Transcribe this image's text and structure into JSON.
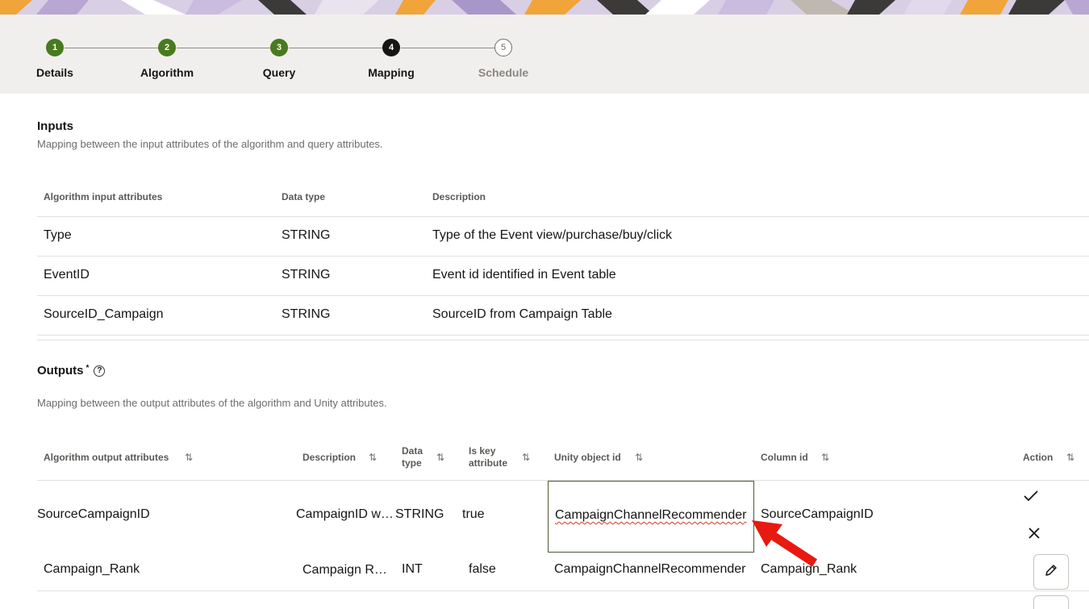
{
  "wizard": {
    "steps": [
      {
        "number": "1",
        "label": "Details",
        "state": "done"
      },
      {
        "number": "2",
        "label": "Algorithm",
        "state": "done"
      },
      {
        "number": "3",
        "label": "Query",
        "state": "done"
      },
      {
        "number": "4",
        "label": "Mapping",
        "state": "current"
      },
      {
        "number": "5",
        "label": "Schedule",
        "state": "future"
      }
    ]
  },
  "inputs": {
    "title": "Inputs",
    "description": "Mapping between the input attributes of the algorithm and query attributes.",
    "columns": [
      "Algorithm input attributes",
      "Data type",
      "Description"
    ],
    "rows": [
      [
        "Type",
        "STRING",
        "Type of the Event view/purchase/buy/click"
      ],
      [
        "EventID",
        "STRING",
        "Event id identified in Event table"
      ],
      [
        "SourceID_Campaign",
        "STRING",
        "SourceID from Campaign Table"
      ]
    ]
  },
  "outputs": {
    "title": "Outputs",
    "required_mark": "*",
    "help_icon": "help-circle-icon",
    "description": "Mapping between the output attributes of the algorithm and Unity attributes.",
    "columns": {
      "attr": "Algorithm output attributes",
      "description": "Description",
      "datatype_1": "Data",
      "datatype_2": "type",
      "iskey_1": "Is key",
      "iskey_2": "attribute",
      "unity": "Unity object id",
      "column": "Column id",
      "action": "Action"
    },
    "sort_icon": "⇅",
    "rows": [
      {
        "attr": "SourceCampaignID",
        "description": "CampaignID w…",
        "datatype": "STRING",
        "iskey": "true",
        "unity": "CampaignChannelRecommender",
        "column": "SourceCampaignID",
        "actions": [
          "check-icon",
          "close-icon"
        ]
      },
      {
        "attr": "Campaign_Rank",
        "description": "Campaign R…",
        "datatype": "INT",
        "iskey": "false",
        "unity": "CampaignChannelRecommender",
        "column": "Campaign_Rank",
        "actions": [
          "pencil-icon"
        ]
      }
    ]
  },
  "colors": {
    "done": "#487a1e",
    "current": "#161513",
    "annotation_arrow": "#e8190f"
  }
}
